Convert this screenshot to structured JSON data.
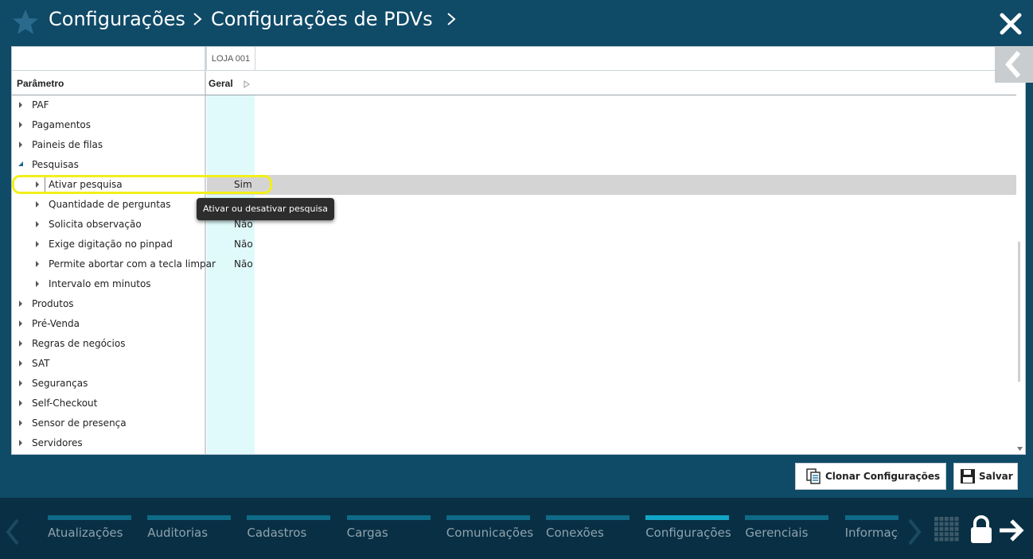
{
  "header": {
    "breadcrumb": [
      "Configurações",
      "Configurações de PDVs"
    ],
    "icons": {
      "star": "star-icon",
      "close": "close-icon"
    }
  },
  "grid": {
    "store_label": "LOJA 001",
    "param_header": "Parâmetro",
    "geral_header": "Geral",
    "rows": [
      {
        "label": "PAF",
        "value": "",
        "level": 0,
        "expanded": false
      },
      {
        "label": "Pagamentos",
        "value": "",
        "level": 0,
        "expanded": false
      },
      {
        "label": "Paineis de filas",
        "value": "",
        "level": 0,
        "expanded": false
      },
      {
        "label": "Pesquisas",
        "value": "",
        "level": 0,
        "expanded": true
      },
      {
        "label": "Ativar pesquisa",
        "value": "Sim",
        "level": 1,
        "selected": true
      },
      {
        "label": "Quantidade de perguntas",
        "value": "",
        "level": 1
      },
      {
        "label": "Solicita observação",
        "value": "Não",
        "level": 1
      },
      {
        "label": "Exige digitação no pinpad",
        "value": "Não",
        "level": 1
      },
      {
        "label": "Permite abortar com a tecla limpar",
        "value": "Não",
        "level": 1
      },
      {
        "label": "Intervalo em minutos",
        "value": "",
        "level": 1
      },
      {
        "label": "Produtos",
        "value": "",
        "level": 0
      },
      {
        "label": "Pré-Venda",
        "value": "",
        "level": 0
      },
      {
        "label": "Regras de negócios",
        "value": "",
        "level": 0
      },
      {
        "label": "SAT",
        "value": "",
        "level": 0
      },
      {
        "label": "Seguranças",
        "value": "",
        "level": 0
      },
      {
        "label": "Self-Checkout",
        "value": "",
        "level": 0
      },
      {
        "label": "Sensor de presença",
        "value": "",
        "level": 0
      },
      {
        "label": "Servidores",
        "value": "",
        "level": 0
      }
    ],
    "tooltip": "Ativar ou desativar pesquisa"
  },
  "actions": {
    "clone_label": "Clonar Configurações",
    "save_label": "Salvar"
  },
  "footer": {
    "tabs": [
      {
        "label": "Atualizações",
        "active": false
      },
      {
        "label": "Auditorias",
        "active": false
      },
      {
        "label": "Cadastros",
        "active": false
      },
      {
        "label": "Cargas",
        "active": false
      },
      {
        "label": "Comunicações",
        "active": false
      },
      {
        "label": "Conexões",
        "active": false
      },
      {
        "label": "Configurações",
        "active": true
      },
      {
        "label": "Gerenciais",
        "active": false
      },
      {
        "label": "Informações",
        "active": false
      }
    ]
  },
  "colors": {
    "header_bg": "#0f4a67",
    "footer_bg": "#082f43",
    "tab_bar": "#0e6a86",
    "tab_bar_active": "#11a6c8",
    "geral_col_bg": "#e0fafb",
    "highlight": "#f3ef1b"
  }
}
